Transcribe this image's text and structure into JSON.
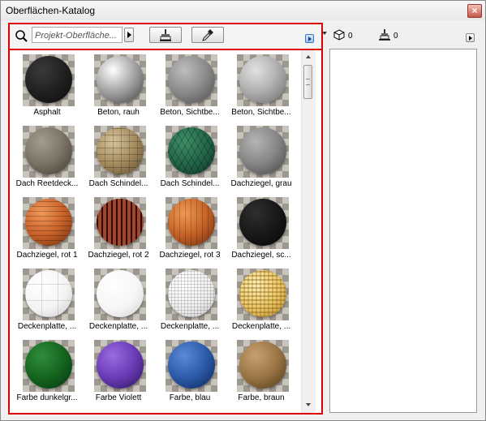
{
  "window": {
    "title": "Oberflächen-Katalog"
  },
  "toolbar": {
    "search_placeholder": "Projekt-Oberfläche...",
    "surface_count": "0",
    "brush_count": "0"
  },
  "colors": {
    "highlight_border": "#e00000",
    "accent_blue": "#3a78c6"
  },
  "surfaces": [
    {
      "label": "Asphalt",
      "material": "asphalt"
    },
    {
      "label": "Beton, rauh",
      "material": "beton-rauh"
    },
    {
      "label": "Beton, Sichtbe...",
      "material": "beton-sicht"
    },
    {
      "label": "Beton, Sichtbe...",
      "material": "beton-sicht-2"
    },
    {
      "label": "Dach Reetdeck...",
      "material": "reet"
    },
    {
      "label": "Dach Schindel...",
      "material": "schindel-holz"
    },
    {
      "label": "Dach Schindel...",
      "material": "schindel-gruen"
    },
    {
      "label": "Dachziegel, grau",
      "material": "ziegel-grau"
    },
    {
      "label": "Dachziegel, rot 1",
      "material": "ziegel-rot-1"
    },
    {
      "label": "Dachziegel, rot 2",
      "material": "ziegel-rot-2"
    },
    {
      "label": "Dachziegel, rot 3",
      "material": "ziegel-rot-3"
    },
    {
      "label": "Dachziegel, sc...",
      "material": "ziegel-schwarz"
    },
    {
      "label": "Deckenplatte, ...",
      "material": "decke-1"
    },
    {
      "label": "Deckenplatte, ...",
      "material": "decke-2"
    },
    {
      "label": "Deckenplatte, ...",
      "material": "decke-3"
    },
    {
      "label": "Deckenplatte, ...",
      "material": "decke-gelb"
    },
    {
      "label": "Farbe dunkelgr...",
      "material": "farbe-dunkelgruen"
    },
    {
      "label": "Farbe Violett",
      "material": "farbe-violett"
    },
    {
      "label": "Farbe, blau",
      "material": "farbe-blau"
    },
    {
      "label": "Farbe, braun",
      "material": "farbe-braun"
    }
  ]
}
